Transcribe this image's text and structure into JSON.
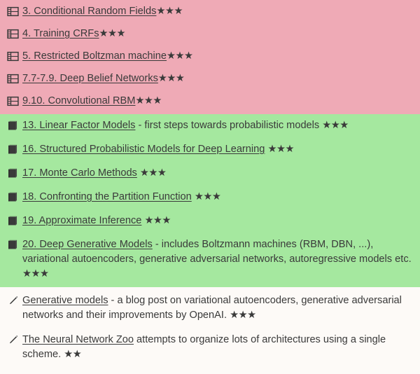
{
  "sections": [
    {
      "id": "pink-section",
      "name": "film-lecture-section",
      "background": "#efaab6",
      "icon": "film-frames-icon",
      "entries": [
        {
          "link": "3. Conditional Random Fields",
          "rest": "",
          "stars": "★★★"
        },
        {
          "link": "4. Training CRFs",
          "rest": "",
          "stars": "★★★"
        },
        {
          "link": "5. Restricted Boltzman machine",
          "rest": "",
          "stars": "★★★"
        },
        {
          "link": "7.7-7.9. Deep Belief Networks",
          "rest": "",
          "stars": "★★★"
        },
        {
          "link": "9.10. Convolutional RBM",
          "rest": "",
          "stars": "★★★"
        }
      ]
    },
    {
      "id": "green-section",
      "name": "book-chapter-section",
      "background": "#a5e89f",
      "icon": "book-icon",
      "entries": [
        {
          "link": "13. Linear Factor Models",
          "rest": " - first steps towards probabilistic models ",
          "stars": "★★★"
        },
        {
          "link": "16. Structured Probabilistic Models for Deep Learning",
          "rest": " ",
          "stars": "★★★"
        },
        {
          "link": "17. Monte Carlo Methods",
          "rest": " ",
          "stars": "★★★"
        },
        {
          "link": "18. Confronting the Partition Function",
          "rest": " ",
          "stars": "★★★"
        },
        {
          "link": "19. Approximate Inference",
          "rest": " ",
          "stars": "★★★"
        },
        {
          "link": "20. Deep Generative Models",
          "rest": " - includes Boltzmann machines (RBM, DBN, ...), variational autoencoders, generative adversarial networks, autoregressive models etc. ",
          "stars": "★★★"
        }
      ]
    },
    {
      "id": "plain-section",
      "name": "blog-post-section",
      "background": "#fdfaf7",
      "icon": "pencil-icon",
      "entries": [
        {
          "link": "Generative models",
          "rest": " - a blog post on variational autoencoders, generative adversarial networks and their improvements by OpenAI. ",
          "stars": "★★★"
        },
        {
          "link": "The Neural Network Zoo",
          "rest": " attempts to organize lots of architectures using a single scheme. ",
          "stars": "★★"
        }
      ]
    }
  ],
  "colors": {
    "pink": "#efaab6",
    "green": "#a5e89f",
    "plain": "#fdfaf7",
    "text": "#3a3a3a",
    "icon_dark": "#3a3a3a"
  }
}
